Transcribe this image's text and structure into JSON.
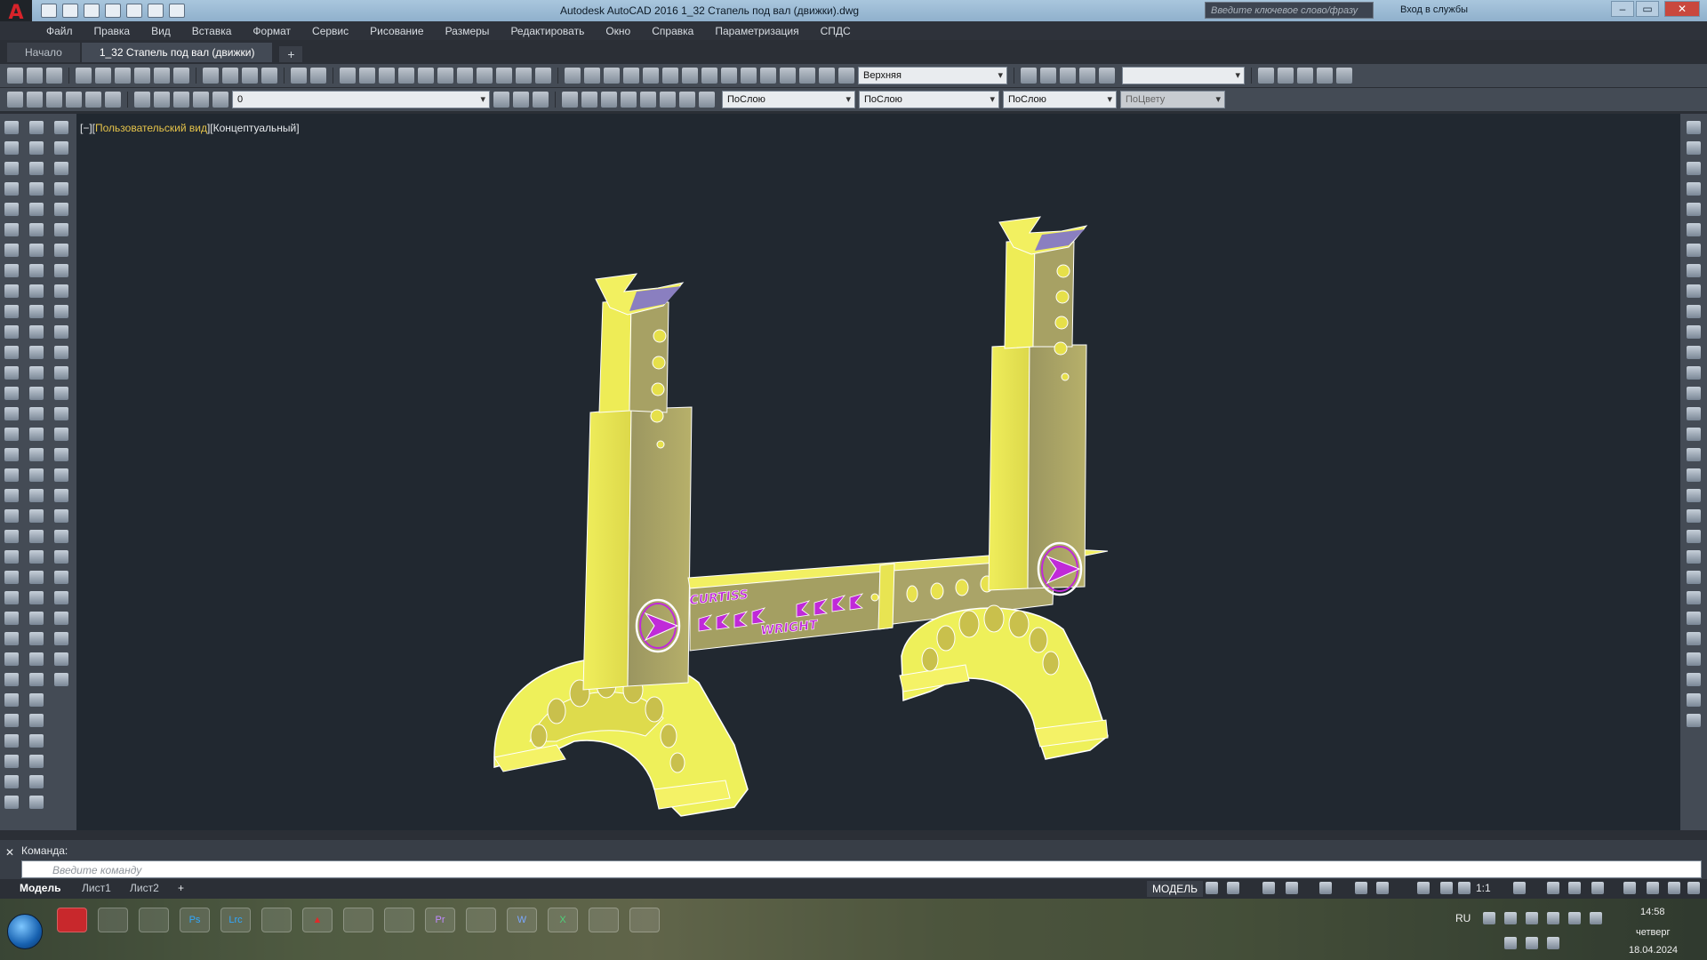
{
  "titlebar": {
    "title": "Autodesk AutoCAD 2016   1_32 Стапель под вал (движки).dwg",
    "search_placeholder": "Введите ключевое слово/фразу",
    "signin": "Вход в службы"
  },
  "menu": [
    "Файл",
    "Правка",
    "Вид",
    "Вставка",
    "Формат",
    "Сервис",
    "Рисование",
    "Размеры",
    "Редактировать",
    "Окно",
    "Справка",
    "Параметризация",
    "СПДС"
  ],
  "tabs": [
    {
      "label": "Начало",
      "active": false
    },
    {
      "label": "1_32 Стапель под вал (движки)",
      "active": true
    }
  ],
  "toolbar": {
    "view_combo": "Верхняя",
    "layer_combo": "0",
    "color_combo": "ПоСлою",
    "linetype_combo": "ПоСлою",
    "lineweight_combo": "ПоСлою",
    "plotstyle_combo": "ПоЦвету"
  },
  "viewport": {
    "label_prefix": "[−][",
    "label_view": "Пользовательский вид",
    "label_style": "][Концептуальный]",
    "logo_text_top": "CURTISS",
    "logo_text_bottom": "WRIGHT"
  },
  "command": {
    "label": "Команда:",
    "placeholder": "Введите команду"
  },
  "status": {
    "layouts": [
      "Модель",
      "Лист1",
      "Лист2"
    ],
    "add": "+",
    "model_button": "МОДЕЛЬ",
    "scale": "1:1"
  },
  "taskbar": {
    "apps": [
      "Ps",
      "Lrc",
      "Pr",
      "W",
      "X"
    ],
    "lang": "RU",
    "time": "14:58",
    "day": "четверг",
    "date": "18.04.2024"
  },
  "colors": {
    "model_yellow": "#ecec4a",
    "model_shadow": "#a6a25c",
    "logo_magenta": "#b32bd0",
    "viewport_bg": "#212830"
  }
}
